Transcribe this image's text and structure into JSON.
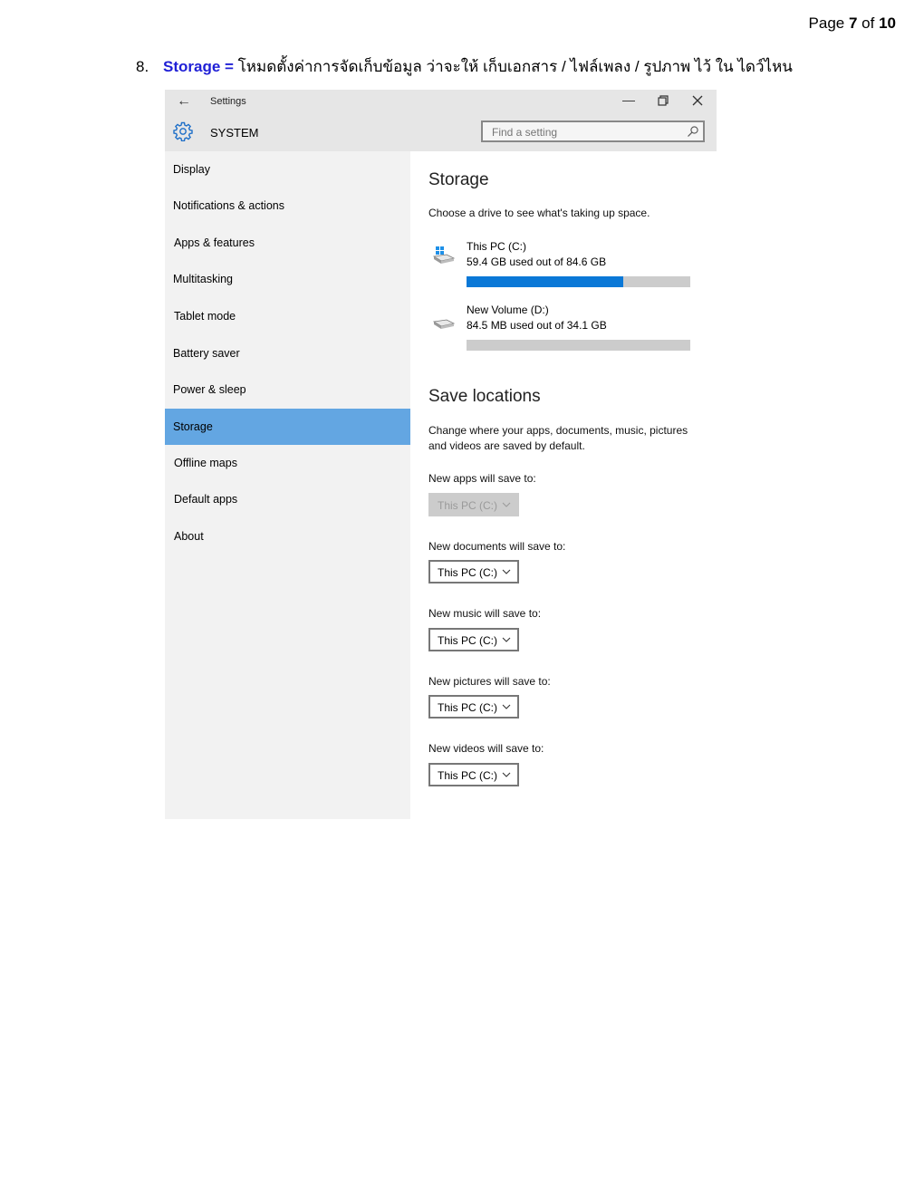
{
  "page": {
    "prefix": "Page ",
    "current": "7",
    "of": " of ",
    "total": "10"
  },
  "heading": {
    "number": "8.",
    "keyword": "Storage =",
    "text": " โหมดตั้งค่าการจัดเก็บข้อมูล ว่าจะให้ เก็บเอกสาร / ไฟล์เพลง / รูปภาพ ไว้ ใน ไดว์ไหน"
  },
  "window": {
    "title": "Settings",
    "section": "SYSTEM",
    "search_placeholder": "Find a setting"
  },
  "sidebar": {
    "items": [
      {
        "label": "Display"
      },
      {
        "label": "Notifications & actions"
      },
      {
        "label": "Apps & features"
      },
      {
        "label": "Multitasking"
      },
      {
        "label": "Tablet mode"
      },
      {
        "label": "Battery saver"
      },
      {
        "label": "Power & sleep"
      },
      {
        "label": "Storage",
        "active": true
      },
      {
        "label": "Offline maps"
      },
      {
        "label": "Default apps"
      },
      {
        "label": "About"
      }
    ]
  },
  "storage": {
    "title": "Storage",
    "description": "Choose a drive to see what's taking up space.",
    "drives": [
      {
        "name": "This PC (C:)",
        "usage": "59.4 GB used out of 84.6 GB",
        "used_fraction": 0.702
      },
      {
        "name": "New Volume (D:)",
        "usage": "84.5 MB used out of 34.1 GB",
        "used_fraction": 0.0
      }
    ]
  },
  "save_locations": {
    "title": "Save locations",
    "description_line1": "Change where your apps, documents, music, pictures",
    "description_line2": "and videos are saved by default.",
    "apps_label": "New apps will save to:",
    "apps_value": "This PC (C:)",
    "documents_label": "New documents will save to:",
    "documents_value": "This PC (C:)",
    "music_label": "New music will save to:",
    "music_value": "This PC (C:)",
    "pictures_label": "New pictures will save to:",
    "pictures_value": "This PC (C:)",
    "videos_label": "New videos will save to:",
    "videos_value": "This PC (C:)"
  },
  "colors": {
    "accent": "#0a78d7",
    "nav_active": "#63a6e2",
    "heading_keyword": "#1f1fd6"
  }
}
